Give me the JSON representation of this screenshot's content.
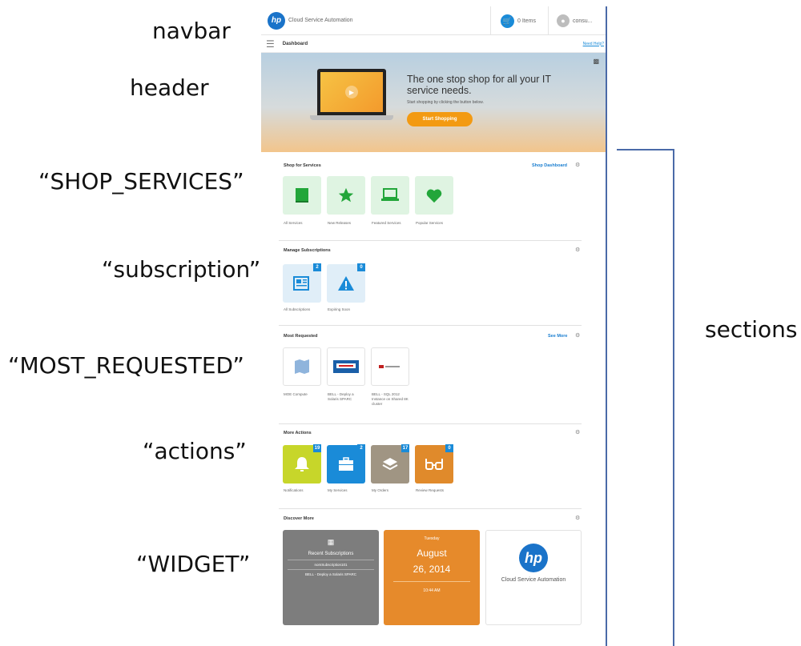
{
  "annotations": {
    "navbar": "navbar",
    "header": "header",
    "shop_services": "“SHOP_SERVICES”",
    "subscription": "“subscription”",
    "most_requested": "“MOST_REQUESTED”",
    "actions": "“actions”",
    "widget": "“WIDGET”",
    "sections": "sections"
  },
  "navbar": {
    "logo_text": "hp",
    "title": "Cloud Service Automation",
    "cart_count": "0 Items",
    "user": "consu..."
  },
  "subbar": {
    "page": "Dashboard",
    "help": "Need Help?"
  },
  "banner": {
    "title": "The one stop shop for all your IT service needs.",
    "subtitle": "Start shopping by clicking the button below.",
    "button": "Start Shopping"
  },
  "shop": {
    "title": "Shop for Services",
    "link": "Shop Dashboard",
    "tiles": [
      {
        "label": "All Services",
        "icon": "book-icon"
      },
      {
        "label": "New Releases",
        "icon": "star-icon"
      },
      {
        "label": "Featured Services",
        "icon": "laptop-icon"
      },
      {
        "label": "Popular Services",
        "icon": "heart-icon"
      }
    ]
  },
  "subscriptions": {
    "title": "Manage Subscriptions",
    "tiles": [
      {
        "label": "All Subscriptions",
        "count": "2",
        "icon": "newspaper-icon"
      },
      {
        "label": "Expiring Soon",
        "count": "0",
        "icon": "warning-icon"
      }
    ]
  },
  "most_requested": {
    "title": "Most Requested",
    "link": "See More",
    "tiles": [
      {
        "label": "MOE Compute"
      },
      {
        "label": "BELL - Deploy a Solaris SPARC"
      },
      {
        "label": "BELL - SQL 2012 Instance on Shared 8K cluster"
      }
    ]
  },
  "actions": {
    "title": "More Actions",
    "tiles": [
      {
        "label": "Notifications",
        "count": "19",
        "color": "#c7d62a"
      },
      {
        "label": "My Services",
        "count": "2",
        "color": "#1a8bd8"
      },
      {
        "label": "My Orders",
        "count": "17",
        "color": "#a09583"
      },
      {
        "label": "Review Requests",
        "count": "0",
        "color": "#e08a2b"
      }
    ]
  },
  "discover": {
    "title": "Discover More",
    "recent": {
      "heading": "Recent Subscriptions",
      "item1": "nomSubscription101",
      "item2": "BELL - Deploy a Solaris SPARC"
    },
    "date": {
      "weekday": "Tuesday",
      "month": "August",
      "day_year": "26, 2014",
      "time": "10:44 AM"
    },
    "brand": {
      "logo": "hp",
      "name": "Cloud Service Automation"
    }
  }
}
